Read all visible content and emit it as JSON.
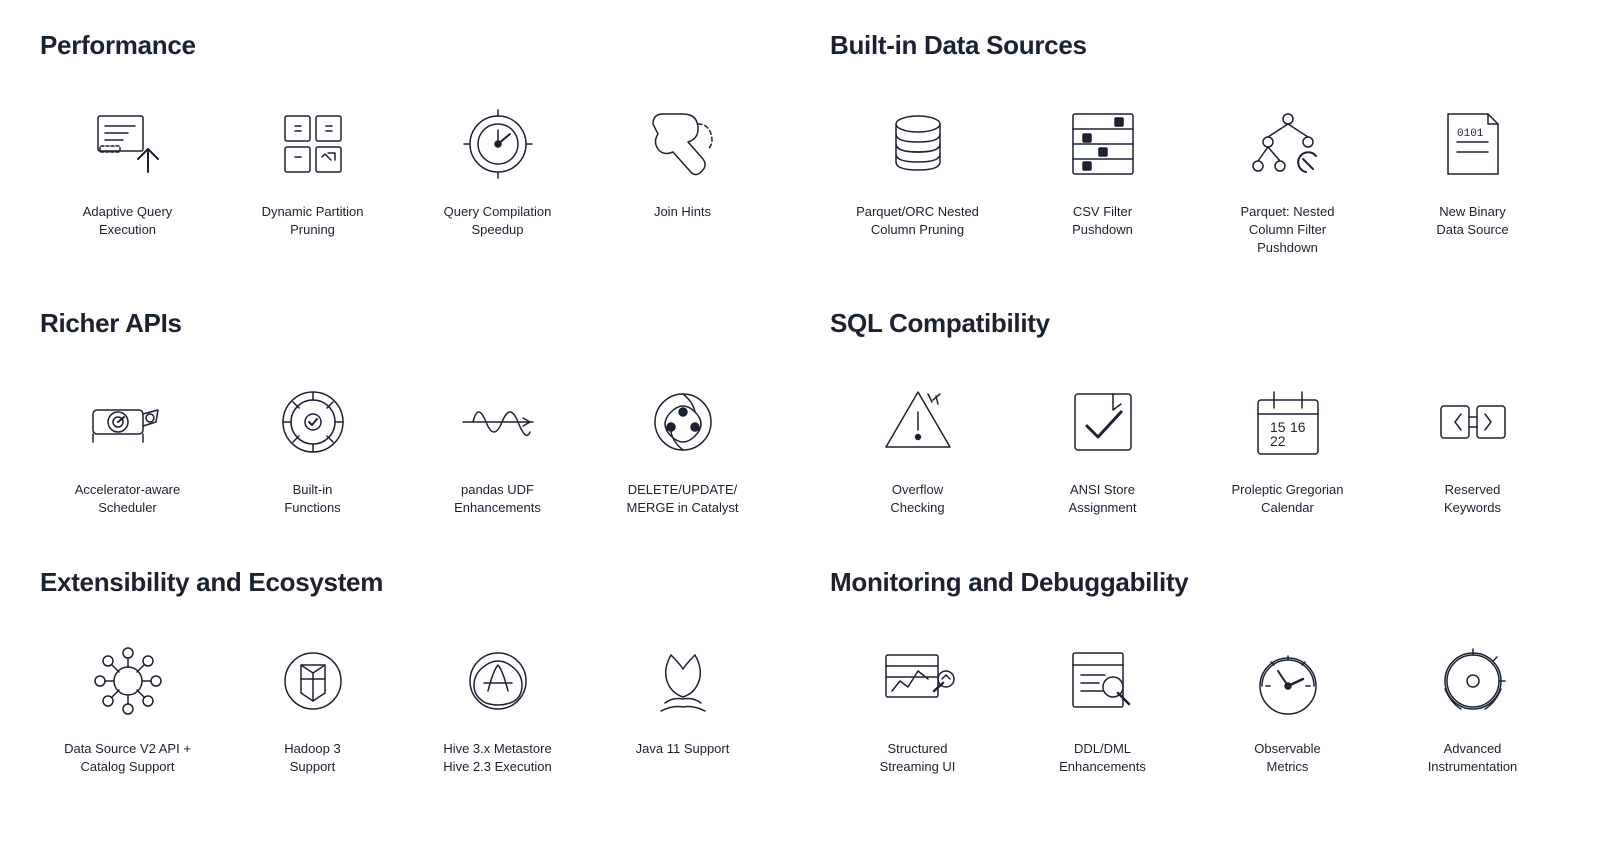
{
  "sections": [
    {
      "id": "performance",
      "title": "Performance",
      "items": [
        {
          "id": "adaptive-query",
          "label": "Adaptive Query\nExecution",
          "icon": "adaptive-query"
        },
        {
          "id": "dynamic-partition",
          "label": "Dynamic Partition\nPruning",
          "icon": "dynamic-partition"
        },
        {
          "id": "query-compilation",
          "label": "Query Compilation\nSpeedup",
          "icon": "query-compilation"
        },
        {
          "id": "join-hints",
          "label": "Join Hints",
          "icon": "join-hints"
        }
      ]
    },
    {
      "id": "built-in-data-sources",
      "title": "Built-in Data Sources",
      "items": [
        {
          "id": "parquet-orc",
          "label": "Parquet/ORC Nested\nColumn Pruning",
          "icon": "parquet-orc"
        },
        {
          "id": "csv-filter",
          "label": "CSV Filter\nPushdown",
          "icon": "csv-filter"
        },
        {
          "id": "parquet-nested",
          "label": "Parquet: Nested\nColumn Filter\nPushdown",
          "icon": "parquet-nested"
        },
        {
          "id": "new-binary",
          "label": "New Binary\nData Source",
          "icon": "new-binary"
        }
      ]
    },
    {
      "id": "richer-apis",
      "title": "Richer APIs",
      "items": [
        {
          "id": "accelerator-aware",
          "label": "Accelerator-aware\nScheduler",
          "icon": "accelerator-aware"
        },
        {
          "id": "built-in-functions",
          "label": "Built-in\nFunctions",
          "icon": "built-in-functions"
        },
        {
          "id": "pandas-udf",
          "label": "pandas UDF\nEnhancements",
          "icon": "pandas-udf"
        },
        {
          "id": "delete-update",
          "label": "DELETE/UPDATE/\nMERGE in Catalyst",
          "icon": "delete-update"
        }
      ]
    },
    {
      "id": "sql-compatibility",
      "title": "SQL Compatibility",
      "items": [
        {
          "id": "overflow-checking",
          "label": "Overflow\nChecking",
          "icon": "overflow-checking"
        },
        {
          "id": "ansi-store",
          "label": "ANSI Store\nAssignment",
          "icon": "ansi-store"
        },
        {
          "id": "proleptic",
          "label": "Proleptic Gregorian\nCalendar",
          "icon": "proleptic"
        },
        {
          "id": "reserved-keywords",
          "label": "Reserved\nKeywords",
          "icon": "reserved-keywords"
        }
      ]
    },
    {
      "id": "extensibility",
      "title": "Extensibility and Ecosystem",
      "items": [
        {
          "id": "datasource-v2",
          "label": "Data Source V2 API +\nCatalog Support",
          "icon": "datasource-v2"
        },
        {
          "id": "hadoop3",
          "label": "Hadoop 3\nSupport",
          "icon": "hadoop3"
        },
        {
          "id": "hive-metastore",
          "label": "Hive 3.x Metastore\nHive 2.3 Execution",
          "icon": "hive-metastore"
        },
        {
          "id": "java11",
          "label": "Java 11 Support",
          "icon": "java11"
        }
      ]
    },
    {
      "id": "monitoring",
      "title": "Monitoring and Debuggability",
      "items": [
        {
          "id": "structured-streaming",
          "label": "Structured\nStreaming UI",
          "icon": "structured-streaming"
        },
        {
          "id": "ddl-dml",
          "label": "DDL/DML\nEnhancements",
          "icon": "ddl-dml"
        },
        {
          "id": "observable-metrics",
          "label": "Observable\nMetrics",
          "icon": "observable-metrics"
        },
        {
          "id": "advanced-instrumentation",
          "label": "Advanced\nInstrumentation",
          "icon": "advanced-instrumentation"
        }
      ]
    }
  ]
}
